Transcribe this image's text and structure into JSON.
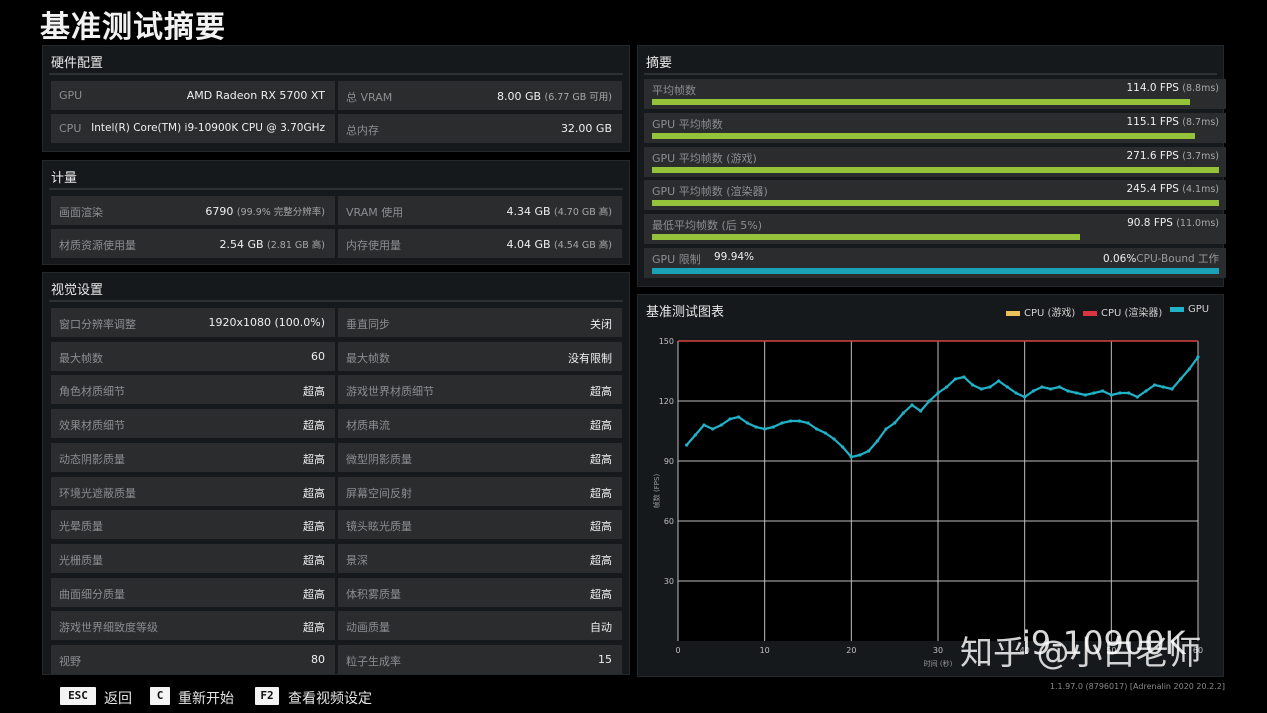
{
  "page_title": "基准测试摘要",
  "hardware": {
    "title": "硬件配置",
    "gpu_label": "GPU",
    "gpu_value": "AMD Radeon RX 5700 XT",
    "vram_label": "总 VRAM",
    "vram_value": "8.00 GB",
    "vram_sub": "(6.77 GB 可用)",
    "cpu_label": "CPU",
    "cpu_value": "Intel(R) Core(TM) i9-10900K CPU @ 3.70GHz",
    "ram_label": "总内存",
    "ram_value": "32.00 GB"
  },
  "metrics": {
    "title": "计量",
    "render_label": "画面渲染",
    "render_value": "6790",
    "render_sub": "(99.9% 完整分辨率)",
    "vram_label": "VRAM 使用",
    "vram_value": "4.34 GB",
    "vram_sub": "(4.70 GB 高)",
    "tex_label": "材质资源使用量",
    "tex_value": "2.54 GB",
    "tex_sub": "(2.81 GB 高)",
    "mem_label": "内存使用量",
    "mem_value": "4.04 GB",
    "mem_sub": "(4.54 GB 高)"
  },
  "visual": {
    "title": "视觉设置",
    "rows": [
      {
        "l_label": "窗口分辨率调整",
        "l_value": "1920x1080 (100.0%)",
        "r_label": "垂直同步",
        "r_value": "关闭"
      },
      {
        "l_label": "最大帧数",
        "l_value": "60",
        "r_label": "最大帧数",
        "r_value": "没有限制"
      },
      {
        "l_label": "角色材质细节",
        "l_value": "超高",
        "r_label": "游戏世界材质细节",
        "r_value": "超高"
      },
      {
        "l_label": "效果材质细节",
        "l_value": "超高",
        "r_label": "材质串流",
        "r_value": "超高"
      },
      {
        "l_label": "动态阴影质量",
        "l_value": "超高",
        "r_label": "微型阴影质量",
        "r_value": "超高"
      },
      {
        "l_label": "环境光遮蔽质量",
        "l_value": "超高",
        "r_label": "屏幕空间反射",
        "r_value": "超高"
      },
      {
        "l_label": "光晕质量",
        "l_value": "超高",
        "r_label": "镜头眩光质量",
        "r_value": "超高"
      },
      {
        "l_label": "光栅质量",
        "l_value": "超高",
        "r_label": "景深",
        "r_value": "超高"
      },
      {
        "l_label": "曲面细分质量",
        "l_value": "超高",
        "r_label": "体积雾质量",
        "r_value": "超高"
      },
      {
        "l_label": "游戏世界细致度等级",
        "l_value": "超高",
        "r_label": "动画质量",
        "r_value": "自动"
      },
      {
        "l_label": "视野",
        "l_value": "80",
        "r_label": "粒子生成率",
        "r_value": "15"
      }
    ]
  },
  "summary": {
    "title": "摘要",
    "bar_color": "#94c23a",
    "gpu_limit_color": "#1aa1b5",
    "rows": [
      {
        "label": "平均帧数",
        "value": "114.0 FPS",
        "sub": "(8.8ms)",
        "fill": 0.948
      },
      {
        "label": "GPU 平均帧数",
        "value": "115.1 FPS",
        "sub": "(8.7ms)",
        "fill": 0.957
      },
      {
        "label": "GPU 平均帧数 (游戏)",
        "value": "271.6 FPS",
        "sub": "(3.7ms)",
        "fill": 1.0
      },
      {
        "label": "GPU 平均帧数 (渲染器)",
        "value": "245.4 FPS",
        "sub": "(4.1ms)",
        "fill": 1.0
      },
      {
        "label": "最低平均帧数 (后 5%)",
        "value": "90.8 FPS",
        "sub": "(11.0ms)",
        "fill": 0.755
      }
    ],
    "limit": {
      "label": "GPU 限制",
      "gpu_pct": "99.94%",
      "cpu_pct": "0.06%",
      "cpu_text": "CPU-Bound 工作",
      "fill": 0.9994
    }
  },
  "chart_data": {
    "type": "scatter",
    "title": "基准测试图表",
    "ylabel": "帧数 (FPS)",
    "xlabel": "时间 (秒)",
    "xlim": [
      0,
      60
    ],
    "ylim": [
      0,
      150
    ],
    "x_ticks": [
      0,
      10,
      20,
      30,
      40,
      50,
      60
    ],
    "y_ticks": [
      30,
      60,
      90,
      120,
      150
    ],
    "grid": true,
    "legend_position": "top-right",
    "series": [
      {
        "name": "CPU (游戏)",
        "color": "#e9c05a",
        "x": [
          0,
          60
        ],
        "y": [
          150,
          150
        ]
      },
      {
        "name": "CPU (渲染器)",
        "color": "#d9343f",
        "x": [
          0,
          60
        ],
        "y": [
          150,
          150
        ]
      },
      {
        "name": "GPU",
        "color": "#20b2c8",
        "x": [
          1,
          2,
          3,
          4,
          5,
          6,
          7,
          8,
          9,
          10,
          11,
          12,
          13,
          14,
          15,
          16,
          17,
          18,
          19,
          20,
          21,
          22,
          23,
          24,
          25,
          26,
          27,
          28,
          29,
          30,
          31,
          32,
          33,
          34,
          35,
          36,
          37,
          38,
          39,
          40,
          41,
          42,
          43,
          44,
          45,
          46,
          47,
          48,
          49,
          50,
          51,
          52,
          53,
          54,
          55,
          56,
          57,
          58,
          59,
          60
        ],
        "y": [
          98,
          103,
          108,
          106,
          108,
          111,
          112,
          109,
          107,
          106,
          107,
          109,
          110,
          110,
          109,
          106,
          104,
          101,
          97,
          92,
          93,
          95,
          100,
          106,
          109,
          114,
          118,
          115,
          120,
          124,
          127,
          131,
          132,
          128,
          126,
          127,
          130,
          127,
          124,
          122,
          125,
          127,
          126,
          127,
          125,
          124,
          123,
          124,
          125,
          123,
          124,
          124,
          122,
          125,
          128,
          127,
          126,
          131,
          136,
          142
        ]
      }
    ]
  },
  "footer": {
    "esc_key": "ESC",
    "esc_label": "返回",
    "c_key": "C",
    "c_label": "重新开始",
    "f2_key": "F2",
    "f2_label": "查看视频设定"
  },
  "watermark": "知乎 @小白老师",
  "watermark_overlay": "i9-10900K",
  "version": "1.1.97.0 (8796017) [Adrenalin 2020 20.2.2]"
}
